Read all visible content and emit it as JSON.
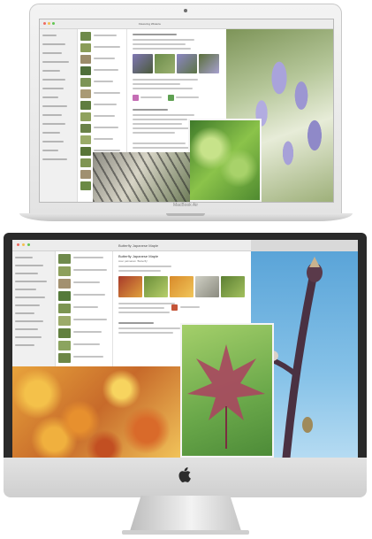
{
  "laptop": {
    "brand_label": "MacBook Air",
    "window_title": "Flowering Wisteria"
  },
  "desktop": {
    "window_title": "Butterfly Japanese Maple",
    "subtitle": "Acer palmatum 'Butterfly'"
  },
  "icons": {
    "camera": "camera-icon",
    "apple": "apple-logo-icon",
    "close": "close-button",
    "minimize": "minimize-button",
    "zoom": "zoom-button"
  }
}
